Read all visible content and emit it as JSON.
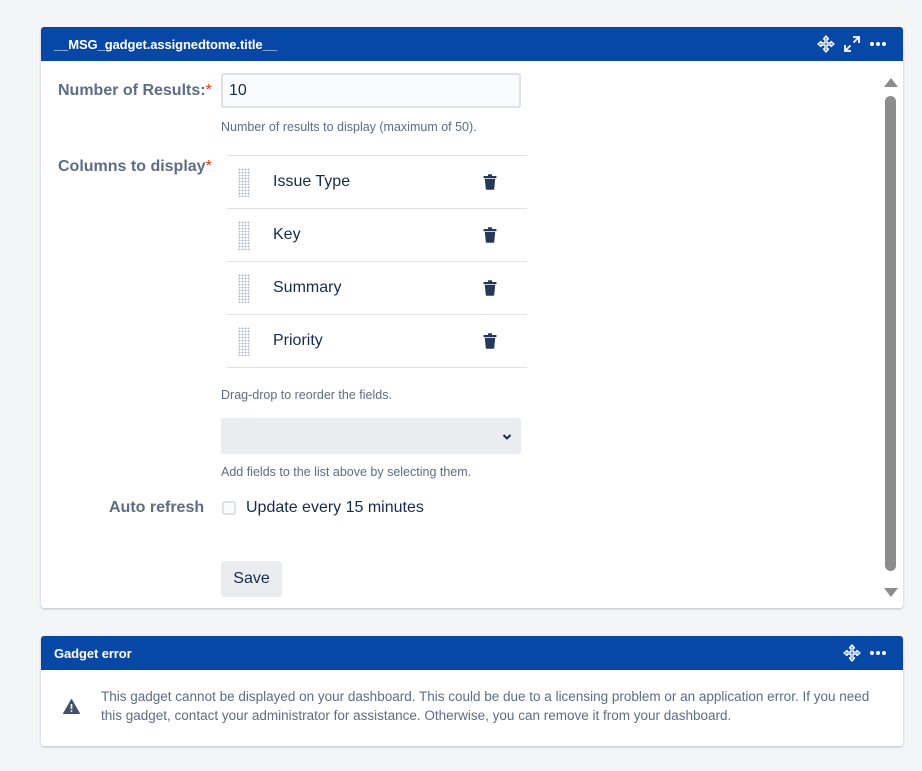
{
  "gadget1": {
    "title": "__MSG_gadget.assignedtome.title__",
    "form": {
      "num_results_label": "Number of Results:",
      "required_mark": "*",
      "num_results_value": "10",
      "num_results_help": "Number of results to display (maximum of 50).",
      "columns_label": "Columns to display",
      "columns": [
        {
          "name": "Issue Type"
        },
        {
          "name": "Key"
        },
        {
          "name": "Summary"
        },
        {
          "name": "Priority"
        }
      ],
      "reorder_help": "Drag-drop to reorder the fields.",
      "select_value": "",
      "add_fields_help": "Add fields to the list above by selecting them.",
      "auto_refresh_label": "Auto refresh",
      "auto_refresh_option": "Update every 15 minutes",
      "auto_refresh_checked": false,
      "save_label": "Save"
    }
  },
  "gadget2": {
    "title": "Gadget error",
    "message": "This gadget cannot be displayed on your dashboard. This could be due to a licensing problem or an application error. If you need this gadget, contact your administrator for assistance. Otherwise, you can remove it from your dashboard."
  },
  "colors": {
    "header_bg": "#0747a6",
    "required": "#de350b",
    "label": "#5e6c84",
    "text": "#172b4d"
  },
  "icons": [
    "move-icon",
    "maximize-icon",
    "more-icon",
    "drag-handle-icon",
    "trash-icon",
    "chevron-down-icon",
    "warning-icon"
  ]
}
